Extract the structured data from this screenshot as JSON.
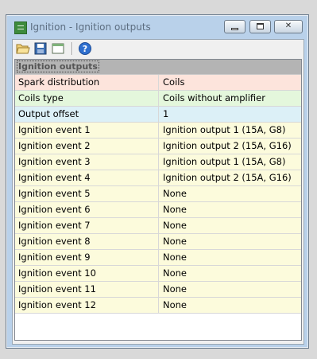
{
  "window": {
    "title": "Ignition - Ignition outputs",
    "icon": "spreadsheet-icon"
  },
  "toolbar": {
    "buttons": [
      {
        "icon": "folder-open-icon"
      },
      {
        "icon": "save-icon"
      },
      {
        "icon": "window-icon"
      },
      {
        "icon": "help-icon"
      }
    ]
  },
  "grid": {
    "category": "Ignition outputs",
    "rows": [
      {
        "name": "Spark distribution",
        "value": "Coils",
        "color": "#fde4dc"
      },
      {
        "name": "Coils type",
        "value": "Coils without amplifier",
        "color": "#e4f7dc"
      },
      {
        "name": "Output offset",
        "value": "1",
        "color": "#dcf0f7"
      },
      {
        "name": "Ignition event 1",
        "value": "Ignition output 1 (15A, G8)",
        "color": "#fcfbdc"
      },
      {
        "name": "Ignition event 2",
        "value": "Ignition output 2 (15A, G16)",
        "color": "#fcfbdc"
      },
      {
        "name": "Ignition event 3",
        "value": "Ignition output 1 (15A, G8)",
        "color": "#fcfbdc"
      },
      {
        "name": "Ignition event 4",
        "value": "Ignition output 2 (15A, G16)",
        "color": "#fcfbdc"
      },
      {
        "name": "Ignition event 5",
        "value": "None",
        "color": "#fcfbdc"
      },
      {
        "name": "Ignition event 6",
        "value": "None",
        "color": "#fcfbdc"
      },
      {
        "name": "Ignition event 7",
        "value": "None",
        "color": "#fcfbdc"
      },
      {
        "name": "Ignition event 8",
        "value": "None",
        "color": "#fcfbdc"
      },
      {
        "name": "Ignition event 9",
        "value": "None",
        "color": "#fcfbdc"
      },
      {
        "name": "Ignition event 10",
        "value": "None",
        "color": "#fcfbdc"
      },
      {
        "name": "Ignition event 11",
        "value": "None",
        "color": "#fcfbdc"
      },
      {
        "name": "Ignition event 12",
        "value": "None",
        "color": "#fcfbdc"
      }
    ]
  }
}
